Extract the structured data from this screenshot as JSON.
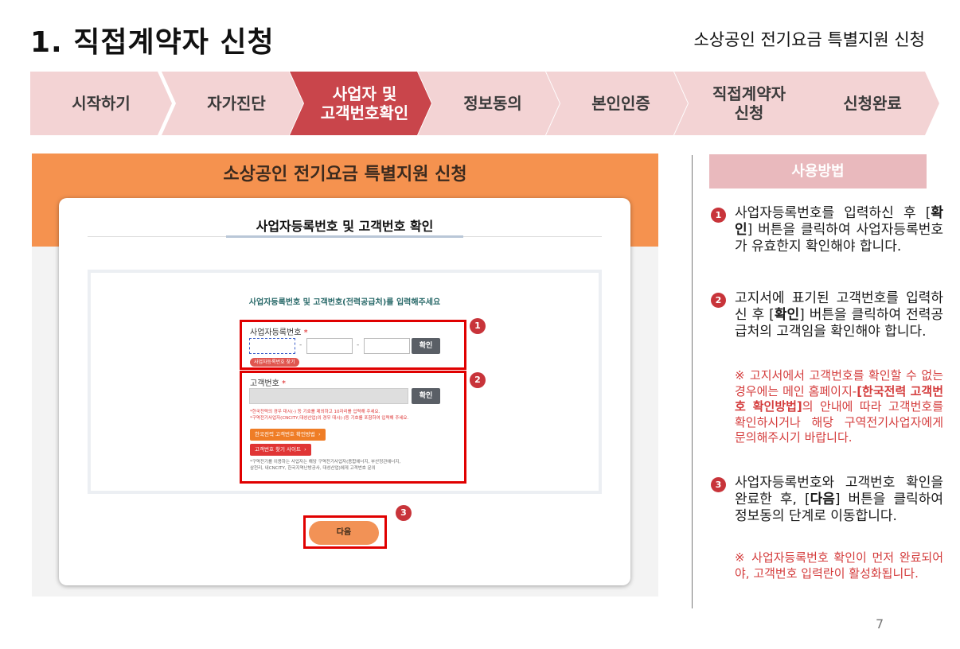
{
  "page": {
    "title": "1. 직접계약자 신청",
    "subtitle": "소상공인 전기요금 특별지원 신청",
    "page_number": "7"
  },
  "steps": [
    {
      "label": "시작하기",
      "active": false
    },
    {
      "label": "자가진단",
      "active": false
    },
    {
      "label_line1": "사업자 및",
      "label_line2": "고객번호확인",
      "active": true
    },
    {
      "label": "정보동의",
      "active": false
    },
    {
      "label": "본인인증",
      "active": false
    },
    {
      "label_line1": "직접계약자",
      "label_line2": "신청",
      "active": false
    },
    {
      "label": "신청완료",
      "active": false
    }
  ],
  "screenshot": {
    "header_title": "소상공인 전기요금 특별지원 신청",
    "card_title": "사업자등록번호 및 고객번호 확인",
    "instruction": "사업자등록번호 및 고객번호(전력공급처)를 입력해주세요",
    "biz_field": {
      "label": "사업자등록번호",
      "required_mark": "*",
      "dash": "-",
      "confirm_label": "확인",
      "find_link": "사업자등록번호 찾기"
    },
    "customer_field": {
      "label": "고객번호",
      "required_mark": "*",
      "confirm_label": "확인",
      "note1": "*한국전력의 경우 대시(-) 등 기호를 제외하고 10자리를 입력해 주세요.",
      "note2": "*구역전기사업자(CNCITY,대성산업)의 경우 대시(-)등 기호를 포함하여 입력해 주세요.",
      "kepco_guide_button": "한국전력 고객번호 확인방법",
      "find_site_button": "고객번호 찾기 사이트",
      "note3": "*구역전기를 이용하는 사업자는 해당 구역전기사업자(종합에너지, 부산정관에너지,",
      "note4": "삼천리, 내CNCITY, 한국지역난방공사, 대성산업)에게 고객번호 문의"
    },
    "next_button": "다음",
    "badges": [
      "1",
      "2",
      "3"
    ]
  },
  "usage": {
    "header": "사용방법",
    "items": [
      {
        "num": "1",
        "pre": "사업자등록번호를 입력하신 후 [",
        "bold": "확인",
        "post": "] 버튼을 클릭하여 사업자등록번호가 유효한지 확인해야 합니다."
      },
      {
        "num": "2",
        "pre": "고지서에 표기된 고객번호를 입력하신 후 [",
        "bold": "확인",
        "post": "] 버튼을 클릭하여 전력공급처의 고객임을 확인해야 합니다.",
        "note_pre": "※ 고지서에서 고객번호를 확인할 수 없는 경우에는 메인 홈페이지-",
        "note_bold": "[한국전력 고객번호 확인방법]",
        "note_post": "의 안내에 따라 고객번호를 확인하시거나 해당 구역전기사업자에게 문의해주시기 바랍니다."
      },
      {
        "num": "3",
        "pre": "사업자등록번호와 고객번호 확인을 완료한 후, [",
        "bold": "다음",
        "post": "] 버튼을 클릭하여 정보동의 단계로 이동합니다.",
        "note": "※ 사업자등록번호 확인이 먼저 완료되어야, 고객번호 입력란이 활성화됩니다."
      }
    ]
  },
  "colors": {
    "step_bg": "#f3d3d4",
    "step_active": "#c9454b",
    "header_orange": "#f5924f",
    "usage_header": "#e9b9bd",
    "badge_red": "#c8343a",
    "highlight_red": "#e00000"
  }
}
